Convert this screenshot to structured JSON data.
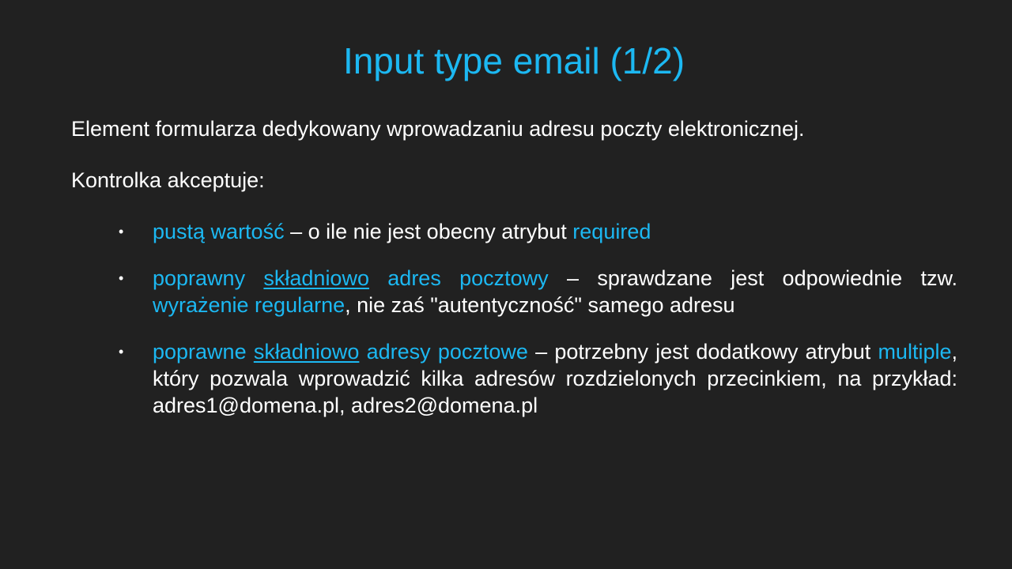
{
  "slide": {
    "title": "Input type email (1/2)",
    "intro": "Element formularza dedykowany wprowadzaniu adresu poczty elektronicznej.",
    "accepts_label": "Kontrolka akceptuje:",
    "bullets": [
      {
        "term": "pustą wartość",
        "text1": " – o ile nie jest obecny atrybut ",
        "attr": "required"
      },
      {
        "term_a": "poprawny ",
        "term_b": "składniowo",
        "term_c": " adres pocztowy",
        "text1": " – sprawdzane jest odpowiednie tzw. ",
        "term2": "wyrażenie regularne",
        "text2": ", nie zaś \"autentyczność\" samego adresu"
      },
      {
        "term_a": "poprawne ",
        "term_b": "składniowo",
        "term_c": " adresy pocztowe",
        "text1": " – potrzebny  jest dodatkowy atrybut ",
        "attr": "multiple",
        "text2": ", który pozwala wprowadzić kilka adresów rozdzielonych przecinkiem, na przykład: adres1@domena.pl, adres2@domena.pl"
      }
    ]
  },
  "colors": {
    "background": "#212121",
    "accent": "#1cb8f2",
    "text": "#ffffff"
  }
}
